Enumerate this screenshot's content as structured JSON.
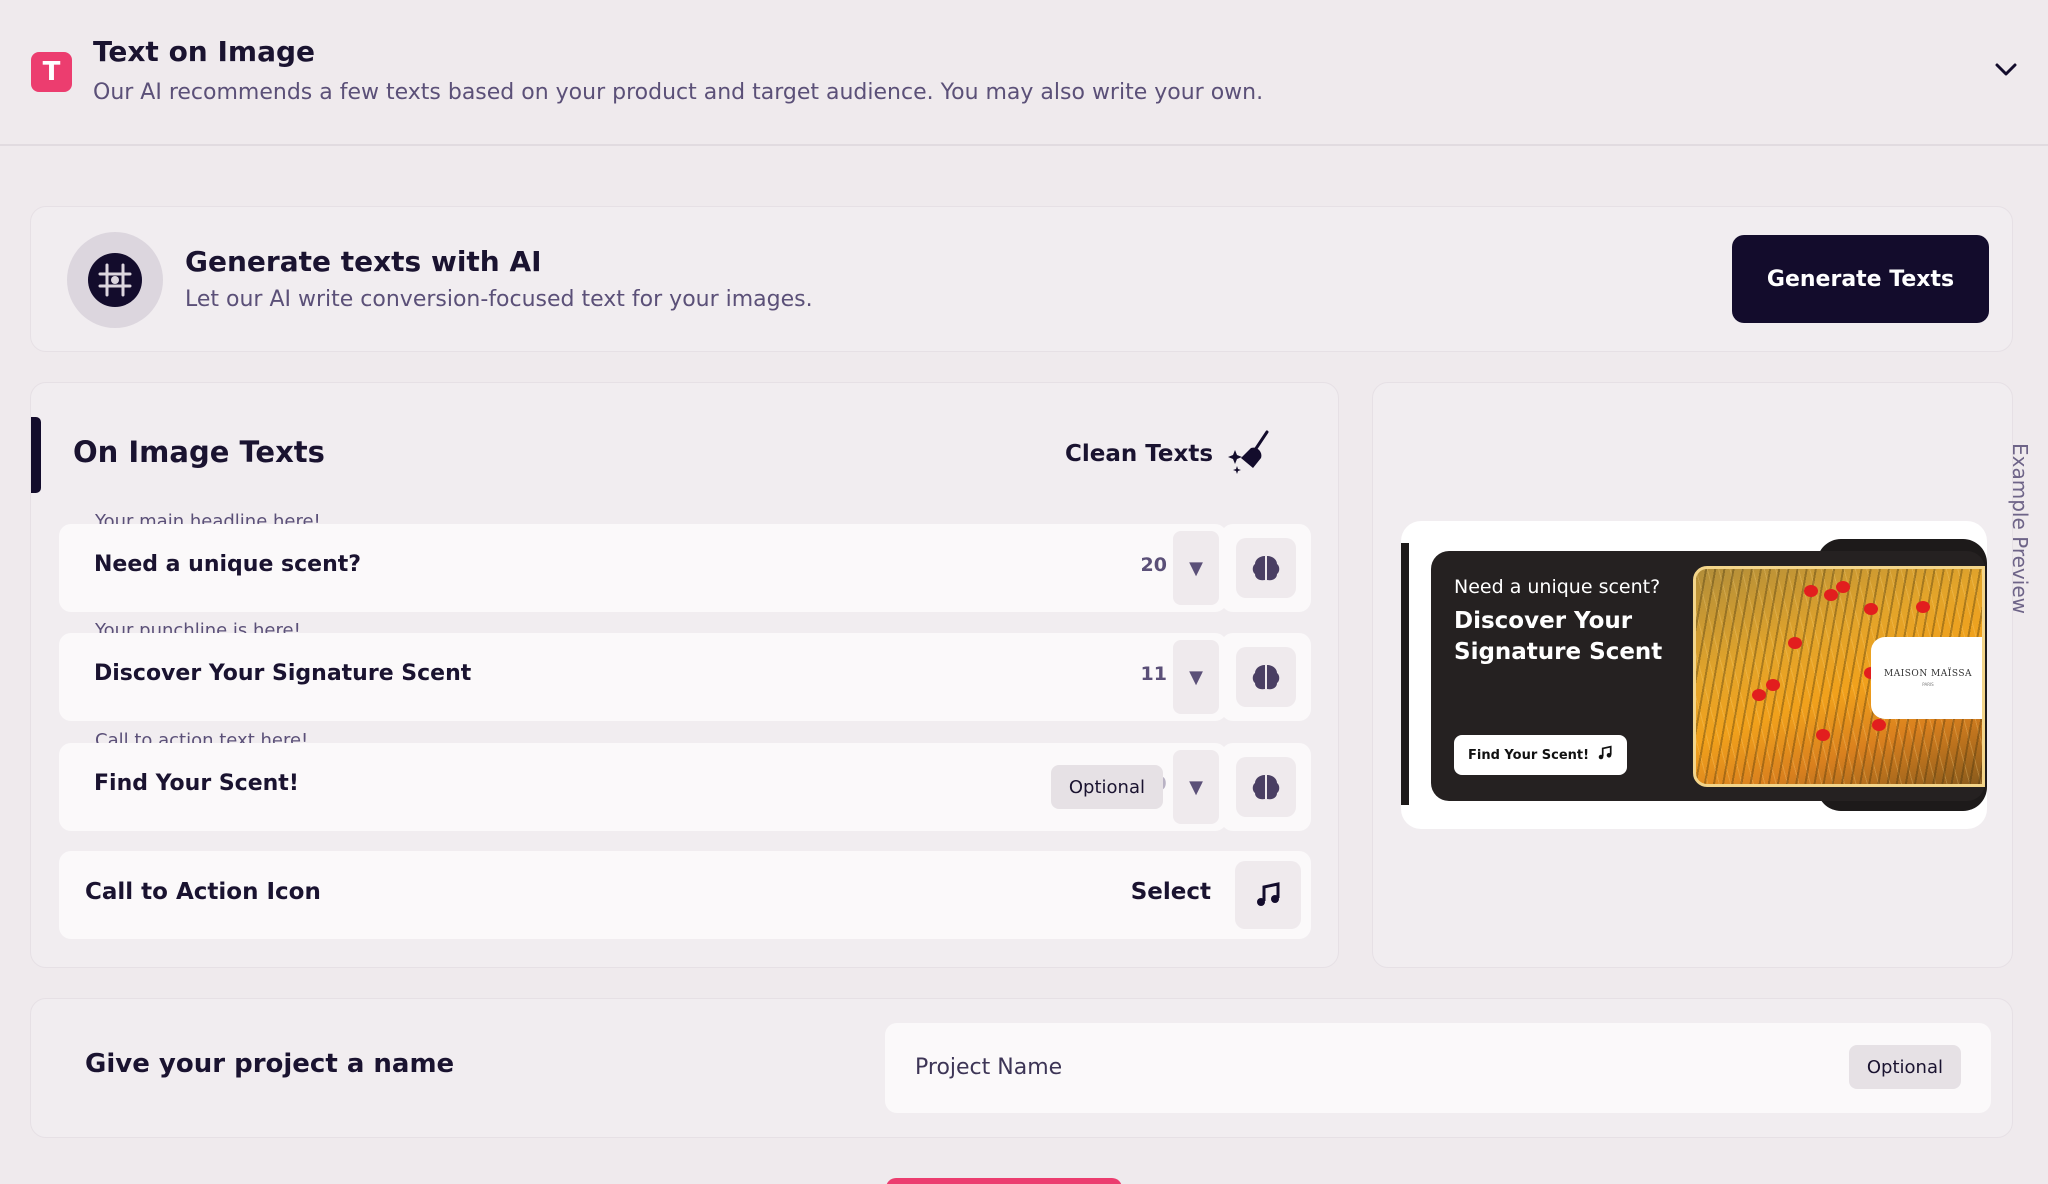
{
  "section": {
    "icon_letter": "T",
    "title": "Text on Image",
    "subtitle": "Our AI recommends a few texts based on your product and target audience. You may also write your own."
  },
  "ai_card": {
    "title": "Generate texts with AI",
    "subtitle": "Let our AI write conversion-focused text for your images.",
    "button_label": "Generate Texts"
  },
  "texts_card": {
    "title": "On Image Texts",
    "clean_label": "Clean Texts",
    "fields": [
      {
        "label": "Your main headline here!",
        "value": "Need a unique scent?",
        "count": "20",
        "optional": ""
      },
      {
        "label": "Your punchline is here!",
        "value": "Discover Your Signature Scent",
        "count": "11",
        "optional": ""
      },
      {
        "label": "Call to action text here!",
        "value": "Find Your Scent!",
        "count": "9",
        "optional": "Optional"
      }
    ],
    "cta_icon": {
      "label": "Call to Action Icon",
      "select_label": "Select"
    }
  },
  "preview": {
    "side_label": "Example Preview",
    "ad_small_text": "Need a unique scent?",
    "ad_big_text": "Discover Your Signature Scent",
    "ad_button_text": "Find Your Scent!",
    "brand_name": "MAISON MAÏSSA",
    "brand_sub": "PARIS"
  },
  "project": {
    "label": "Give your project a name",
    "placeholder": "Project Name",
    "optional": "Optional"
  },
  "colors": {
    "brand_pink": "#ec3d6f",
    "dark": "#130c2c",
    "muted_text": "#5b5078"
  }
}
